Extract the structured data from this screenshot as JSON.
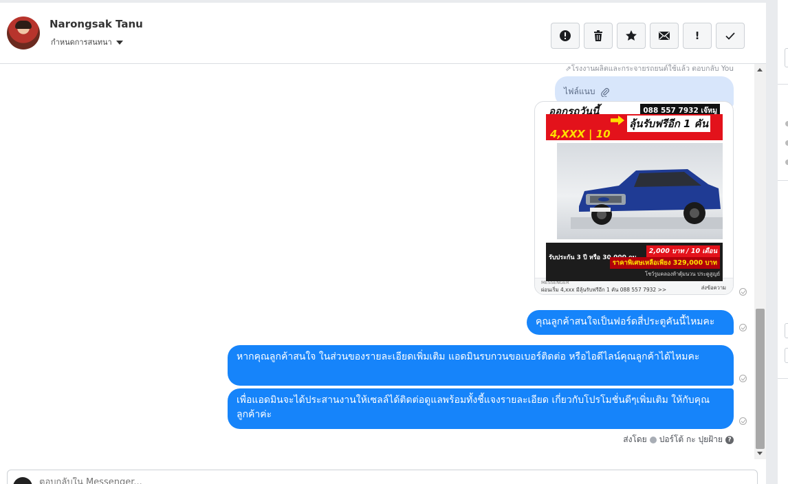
{
  "header": {
    "contact_name": "Narongsak Tanu",
    "assign_label": "กำหนดการสนทนา",
    "actions": {
      "spam": "!",
      "delete": "trash",
      "star": "star",
      "mail": "mail",
      "important": "!",
      "done": "check"
    }
  },
  "thread": {
    "context_text": "⇗โรงงานผลิตและกระจายรถยนต์ใช้แล้ว ตอบกลับ You",
    "attachment_label": "ไฟล์แนบ",
    "ad": {
      "title": "ออกรถวันนี้",
      "phone": "088 557 7932 เจ๊หมู",
      "price_line": "4,XXX | 10",
      "free_line": "ลุ้นรับฟรีอีก 1 คัน",
      "warranty": "รับประกัน 3 ปี หรือ 30,000 กม.",
      "monthly": "2,000 บาท / 10 เดือน",
      "special_price": "ราคาพิเศษเหลือเพียง 329,000 บาท",
      "address": "โชว์รูมคลองห้าตุ้มนวน ประตูสูญย์"
    },
    "card_footer": {
      "source": "MESSENGER",
      "text": "ผ่อนเริ่ม 4,xxx มีลุ้นรับฟรีอีก 1 คัน 088 557 7932 >>",
      "button": "ส่งข้อความ"
    },
    "messages": [
      "คุณลูกค้าสนใจเป็นฟอร์ดสี่ประตูคันนี้ไหมคะ",
      "หากคุณลูกค้าสนใจ ในส่วนของรายละเอียดเพิ่มเติม แอดมินรบกวนขอเบอร์ติดต่อ หรือไอดีไลน์คุณลูกค้าได้ไหมคะ",
      "เพื่อแอดมินจะได้ประสานงานให้เซลล์ได้ติดต่อดูแลพร้อมทั้งชี้แจงรายละเอียด เกี่ยวกับโปรโมชั่นดีๆเพิ่มเติม ให้กับคุณลูกค้าค่ะ"
    ],
    "sent_by_label": "ส่งโดย",
    "sent_by_name": "ปอร์โต้ กะ ปุยฝ้าย"
  },
  "composer": {
    "placeholder": "ตอบกลับใน Messenger..."
  },
  "colors": {
    "bubble": "#1684fa",
    "attach_bubble": "#d8e6fb",
    "border": "#dadde1"
  }
}
